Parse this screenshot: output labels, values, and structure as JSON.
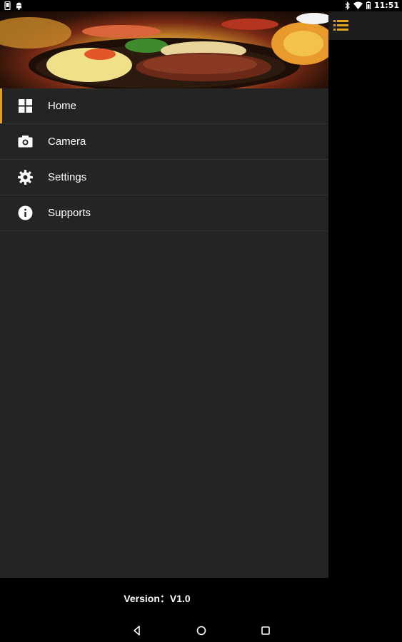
{
  "status_bar": {
    "time": "11:51"
  },
  "header": {
    "image_desc_icon": "food-header-image"
  },
  "nav": {
    "items": [
      {
        "label": "Home",
        "icon": "home-grid-icon",
        "active": true
      },
      {
        "label": "Camera",
        "icon": "camera-icon",
        "active": false
      },
      {
        "label": "Settings",
        "icon": "gear-icon",
        "active": false
      },
      {
        "label": "Supports",
        "icon": "info-icon",
        "active": false
      }
    ]
  },
  "footer": {
    "version": "Version：V1.0"
  },
  "colors": {
    "accent": "#e3a11a",
    "drawer_bg": "#242424",
    "toolbar_bg": "#1c1c1c"
  }
}
